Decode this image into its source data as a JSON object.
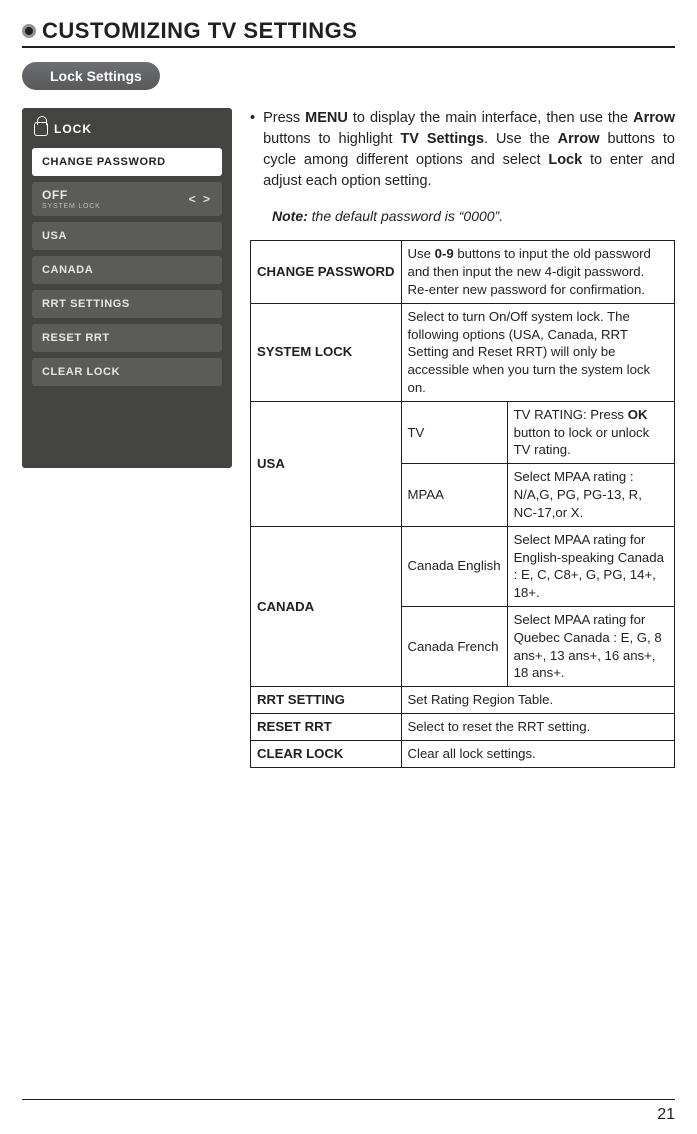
{
  "pageTitle": "CUSTOMIZING TV SETTINGS",
  "subHeading": "Lock Settings",
  "menu": {
    "header": "LOCK",
    "items": {
      "changePassword": "CHANGE PASSWORD",
      "offBig": "OFF",
      "offSmall": "SYSTEM LOCK",
      "arrows": "<  >",
      "usa": "USA",
      "canada": "CANADA",
      "rrtSettings": "RRT SETTINGS",
      "resetRrt": "RESET RRT",
      "clearLock": "CLEAR LOCK"
    }
  },
  "intro": {
    "bullet": "•",
    "p1a": "Press ",
    "p1b": "MENU",
    "p1c": " to display the main interface, then use the ",
    "p1d": "Arrow",
    "p1e": " buttons to highlight ",
    "p1f": "TV Settings",
    "p1g": ". Use the ",
    "p1h": "Arrow",
    "p1i": " buttons to cycle among different options and select ",
    "p1j": "Lock",
    "p1k": " to enter and adjust each option setting."
  },
  "note": {
    "label": "Note:",
    "text": " the default password is “0000”."
  },
  "table": {
    "changePassword": {
      "label": "CHANGE PASSWORD",
      "desc1": "Use ",
      "desc2": "0-9",
      "desc3": " buttons to input the old password and then input the new 4-digit password. Re-enter new password for confirmation."
    },
    "systemLock": {
      "label": "SYSTEM LOCK",
      "desc": "Select to turn On/Off system lock. The following options (USA, Canada, RRT Setting and Reset RRT) will only be accessible when you turn the system lock on."
    },
    "usa": {
      "label": "USA",
      "tv": {
        "sub": "TV",
        "desc1": "TV RATING: Press ",
        "desc2": "OK",
        "desc3": " button to lock or unlock TV rating."
      },
      "mpaa": {
        "sub": "MPAA",
        "desc": "Select MPAA rating : N/A,G, PG, PG-13, R, NC-17,or X."
      }
    },
    "canada": {
      "label": "CANADA",
      "eng": {
        "sub": "Canada English",
        "desc": "Select MPAA rating for English-speaking Canada : E, C, C8+, G, PG, 14+, 18+."
      },
      "fr": {
        "sub": "Canada French",
        "desc": "Select MPAA rating for Quebec Canada : E, G, 8 ans+, 13 ans+, 16 ans+, 18 ans+."
      }
    },
    "rrtSetting": {
      "label": "RRT SETTING",
      "desc": "Set Rating Region Table."
    },
    "resetRrt": {
      "label": "RESET RRT",
      "desc": "Select to reset the RRT setting."
    },
    "clearLock": {
      "label": "CLEAR LOCK",
      "desc": "Clear all lock settings."
    }
  },
  "pageNumber": "21"
}
